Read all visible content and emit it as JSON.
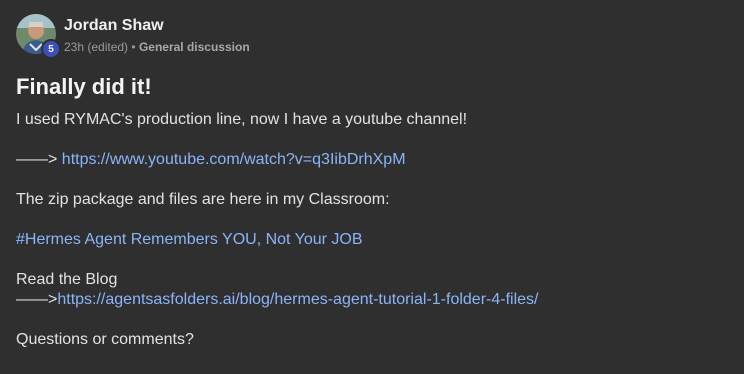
{
  "author": {
    "name": "Jordan Shaw",
    "level": "5",
    "time": "23h (edited)",
    "separator": "•",
    "category": "General discussion"
  },
  "post": {
    "title": "Finally did it!",
    "line1": "I used RYMAC's production line, now I have a youtube channel!",
    "arrow1": "——> ",
    "youtube_link": "https://www.youtube.com/watch?v=q3IibDrhXpM",
    "line2": "The zip package and files are here in my Classroom:",
    "classroom_link": "#Hermes Agent Remembers YOU, Not Your JOB",
    "blog_label": "Read the Blog",
    "arrow2": "——>",
    "blog_link": "https://agentsasfolders.ai/blog/hermes-agent-tutorial-1-folder-4-files/",
    "closing": "Questions or comments?"
  },
  "colors": {
    "background": "#2f2f2f",
    "link": "#8ab4f8",
    "badge": "#3b4fb8"
  }
}
